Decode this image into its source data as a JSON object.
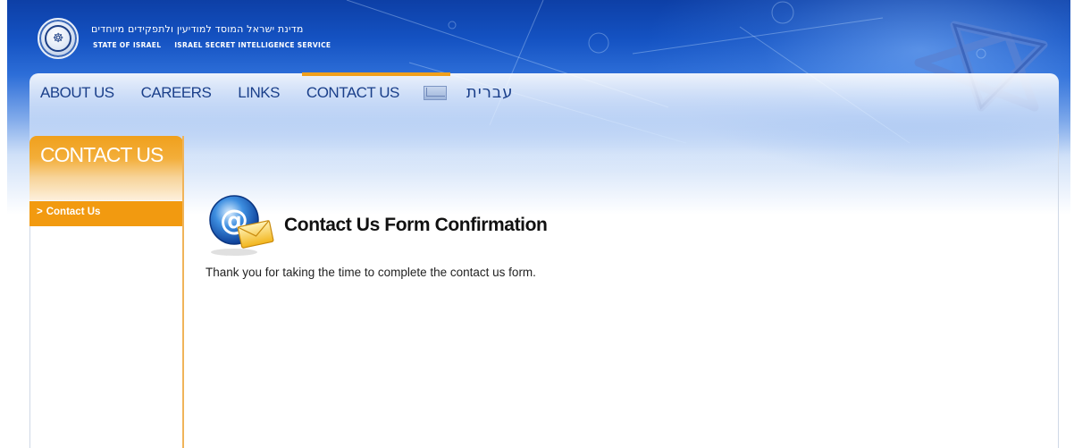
{
  "header": {
    "hebrew_title": "מדינת ישראל המוסד למודיעין ולתפקידים מיוחדים",
    "english_line": [
      "STATE OF ISRAEL",
      "ISRAEL SECRET INTELLIGENCE SERVICE"
    ],
    "seal_glyph": "☸"
  },
  "nav": {
    "items": [
      {
        "label": "ABOUT US",
        "active": false
      },
      {
        "label": "CAREERS",
        "active": false
      },
      {
        "label": "LINKS",
        "active": false
      },
      {
        "label": "CONTACT US",
        "active": true
      }
    ],
    "mail_icon": "envelope-icon",
    "hebrew_link": "עברית"
  },
  "sidebar": {
    "title": "CONTACT US",
    "items": [
      {
        "label": "Contact Us",
        "prefix": ">"
      }
    ]
  },
  "main": {
    "icon": "email-at-envelope-icon",
    "title": "Contact Us Form Confirmation",
    "message": "Thank you for taking the time to complete the contact us form."
  },
  "colors": {
    "header_blue": "#1452c2",
    "nav_text": "#1a3f8a",
    "accent_orange": "#f29a10"
  }
}
